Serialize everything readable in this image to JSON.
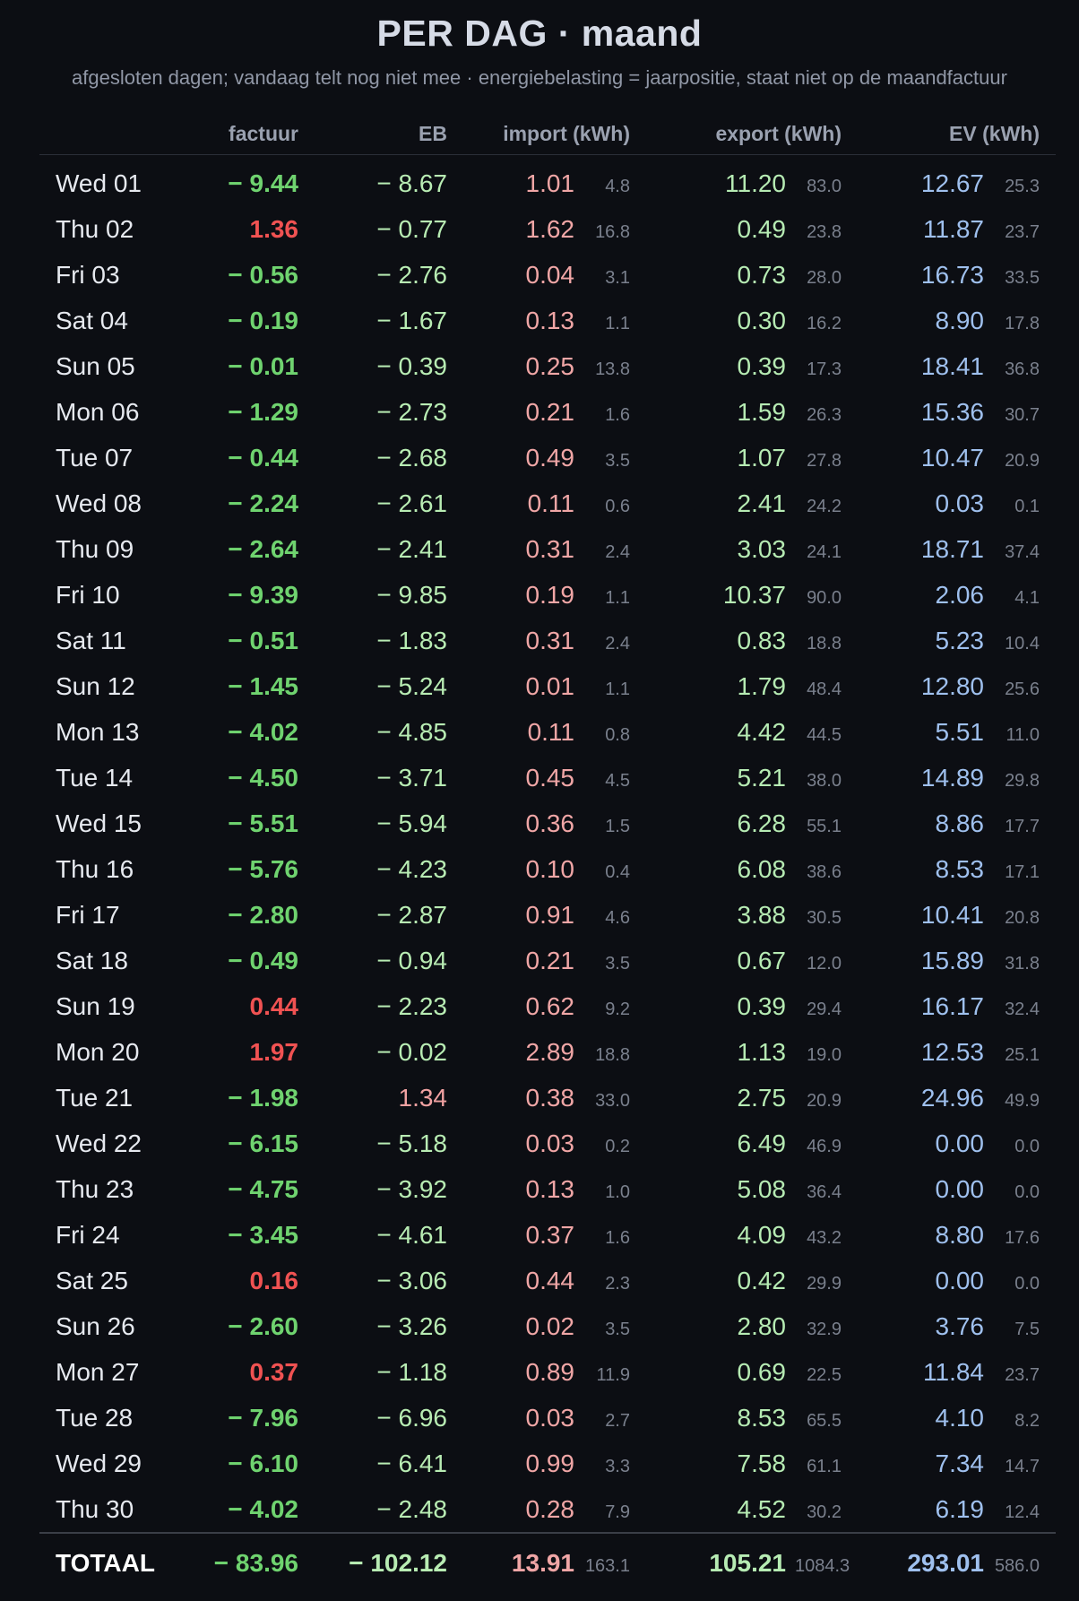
{
  "header": {
    "title": "PER DAG · maand",
    "subtitle": "afgesloten dagen; vandaag telt nog niet mee · energiebelasting = jaarpositie, staat niet op de maandfactuur"
  },
  "columns": {
    "day": "",
    "factuur": "factuur",
    "eb": "EB",
    "import": "import (kWh)",
    "export": "export (kWh)",
    "ev": "EV (kWh)"
  },
  "colors": {
    "negative_invoice": "#6fd36f",
    "positive_invoice": "#f05252",
    "import": "#f0a6a6",
    "export": "#b6ebb3",
    "ev": "#9fc0ee",
    "background": "#0c0e13"
  },
  "rows": [
    {
      "day": "Wed 01",
      "factuur": "− 9.44",
      "factuur_sign": "neg",
      "eb": "− 8.67",
      "eb_sign": "neg",
      "import": "1.01",
      "import_sub": "4.8",
      "export": "11.20",
      "export_sub": "83.0",
      "ev": "12.67",
      "ev_sub": "25.3"
    },
    {
      "day": "Thu 02",
      "factuur": "1.36",
      "factuur_sign": "pos",
      "eb": "− 0.77",
      "eb_sign": "neg",
      "import": "1.62",
      "import_sub": "16.8",
      "export": "0.49",
      "export_sub": "23.8",
      "ev": "11.87",
      "ev_sub": "23.7"
    },
    {
      "day": "Fri 03",
      "factuur": "− 0.56",
      "factuur_sign": "neg",
      "eb": "− 2.76",
      "eb_sign": "neg",
      "import": "0.04",
      "import_sub": "3.1",
      "export": "0.73",
      "export_sub": "28.0",
      "ev": "16.73",
      "ev_sub": "33.5"
    },
    {
      "day": "Sat 04",
      "factuur": "− 0.19",
      "factuur_sign": "neg",
      "eb": "− 1.67",
      "eb_sign": "neg",
      "import": "0.13",
      "import_sub": "1.1",
      "export": "0.30",
      "export_sub": "16.2",
      "ev": "8.90",
      "ev_sub": "17.8"
    },
    {
      "day": "Sun 05",
      "factuur": "− 0.01",
      "factuur_sign": "neg",
      "eb": "− 0.39",
      "eb_sign": "neg",
      "import": "0.25",
      "import_sub": "13.8",
      "export": "0.39",
      "export_sub": "17.3",
      "ev": "18.41",
      "ev_sub": "36.8"
    },
    {
      "day": "Mon 06",
      "factuur": "− 1.29",
      "factuur_sign": "neg",
      "eb": "− 2.73",
      "eb_sign": "neg",
      "import": "0.21",
      "import_sub": "1.6",
      "export": "1.59",
      "export_sub": "26.3",
      "ev": "15.36",
      "ev_sub": "30.7"
    },
    {
      "day": "Tue 07",
      "factuur": "− 0.44",
      "factuur_sign": "neg",
      "eb": "− 2.68",
      "eb_sign": "neg",
      "import": "0.49",
      "import_sub": "3.5",
      "export": "1.07",
      "export_sub": "27.8",
      "ev": "10.47",
      "ev_sub": "20.9"
    },
    {
      "day": "Wed 08",
      "factuur": "− 2.24",
      "factuur_sign": "neg",
      "eb": "− 2.61",
      "eb_sign": "neg",
      "import": "0.11",
      "import_sub": "0.6",
      "export": "2.41",
      "export_sub": "24.2",
      "ev": "0.03",
      "ev_sub": "0.1"
    },
    {
      "day": "Thu 09",
      "factuur": "− 2.64",
      "factuur_sign": "neg",
      "eb": "− 2.41",
      "eb_sign": "neg",
      "import": "0.31",
      "import_sub": "2.4",
      "export": "3.03",
      "export_sub": "24.1",
      "ev": "18.71",
      "ev_sub": "37.4"
    },
    {
      "day": "Fri 10",
      "factuur": "− 9.39",
      "factuur_sign": "neg",
      "eb": "− 9.85",
      "eb_sign": "neg",
      "import": "0.19",
      "import_sub": "1.1",
      "export": "10.37",
      "export_sub": "90.0",
      "ev": "2.06",
      "ev_sub": "4.1"
    },
    {
      "day": "Sat 11",
      "factuur": "− 0.51",
      "factuur_sign": "neg",
      "eb": "− 1.83",
      "eb_sign": "neg",
      "import": "0.31",
      "import_sub": "2.4",
      "export": "0.83",
      "export_sub": "18.8",
      "ev": "5.23",
      "ev_sub": "10.4"
    },
    {
      "day": "Sun 12",
      "factuur": "− 1.45",
      "factuur_sign": "neg",
      "eb": "− 5.24",
      "eb_sign": "neg",
      "import": "0.01",
      "import_sub": "1.1",
      "export": "1.79",
      "export_sub": "48.4",
      "ev": "12.80",
      "ev_sub": "25.6"
    },
    {
      "day": "Mon 13",
      "factuur": "− 4.02",
      "factuur_sign": "neg",
      "eb": "− 4.85",
      "eb_sign": "neg",
      "import": "0.11",
      "import_sub": "0.8",
      "export": "4.42",
      "export_sub": "44.5",
      "ev": "5.51",
      "ev_sub": "11.0"
    },
    {
      "day": "Tue 14",
      "factuur": "− 4.50",
      "factuur_sign": "neg",
      "eb": "− 3.71",
      "eb_sign": "neg",
      "import": "0.45",
      "import_sub": "4.5",
      "export": "5.21",
      "export_sub": "38.0",
      "ev": "14.89",
      "ev_sub": "29.8"
    },
    {
      "day": "Wed 15",
      "factuur": "− 5.51",
      "factuur_sign": "neg",
      "eb": "− 5.94",
      "eb_sign": "neg",
      "import": "0.36",
      "import_sub": "1.5",
      "export": "6.28",
      "export_sub": "55.1",
      "ev": "8.86",
      "ev_sub": "17.7"
    },
    {
      "day": "Thu 16",
      "factuur": "− 5.76",
      "factuur_sign": "neg",
      "eb": "− 4.23",
      "eb_sign": "neg",
      "import": "0.10",
      "import_sub": "0.4",
      "export": "6.08",
      "export_sub": "38.6",
      "ev": "8.53",
      "ev_sub": "17.1"
    },
    {
      "day": "Fri 17",
      "factuur": "− 2.80",
      "factuur_sign": "neg",
      "eb": "− 2.87",
      "eb_sign": "neg",
      "import": "0.91",
      "import_sub": "4.6",
      "export": "3.88",
      "export_sub": "30.5",
      "ev": "10.41",
      "ev_sub": "20.8"
    },
    {
      "day": "Sat 18",
      "factuur": "− 0.49",
      "factuur_sign": "neg",
      "eb": "− 0.94",
      "eb_sign": "neg",
      "import": "0.21",
      "import_sub": "3.5",
      "export": "0.67",
      "export_sub": "12.0",
      "ev": "15.89",
      "ev_sub": "31.8"
    },
    {
      "day": "Sun 19",
      "factuur": "0.44",
      "factuur_sign": "pos",
      "eb": "− 2.23",
      "eb_sign": "neg",
      "import": "0.62",
      "import_sub": "9.2",
      "export": "0.39",
      "export_sub": "29.4",
      "ev": "16.17",
      "ev_sub": "32.4"
    },
    {
      "day": "Mon 20",
      "factuur": "1.97",
      "factuur_sign": "pos",
      "eb": "− 0.02",
      "eb_sign": "neg",
      "import": "2.89",
      "import_sub": "18.8",
      "export": "1.13",
      "export_sub": "19.0",
      "ev": "12.53",
      "ev_sub": "25.1"
    },
    {
      "day": "Tue 21",
      "factuur": "− 1.98",
      "factuur_sign": "neg",
      "eb": "1.34",
      "eb_sign": "pos",
      "import": "0.38",
      "import_sub": "33.0",
      "export": "2.75",
      "export_sub": "20.9",
      "ev": "24.96",
      "ev_sub": "49.9"
    },
    {
      "day": "Wed 22",
      "factuur": "− 6.15",
      "factuur_sign": "neg",
      "eb": "− 5.18",
      "eb_sign": "neg",
      "import": "0.03",
      "import_sub": "0.2",
      "export": "6.49",
      "export_sub": "46.9",
      "ev": "0.00",
      "ev_sub": "0.0"
    },
    {
      "day": "Thu 23",
      "factuur": "− 4.75",
      "factuur_sign": "neg",
      "eb": "− 3.92",
      "eb_sign": "neg",
      "import": "0.13",
      "import_sub": "1.0",
      "export": "5.08",
      "export_sub": "36.4",
      "ev": "0.00",
      "ev_sub": "0.0"
    },
    {
      "day": "Fri 24",
      "factuur": "− 3.45",
      "factuur_sign": "neg",
      "eb": "− 4.61",
      "eb_sign": "neg",
      "import": "0.37",
      "import_sub": "1.6",
      "export": "4.09",
      "export_sub": "43.2",
      "ev": "8.80",
      "ev_sub": "17.6"
    },
    {
      "day": "Sat 25",
      "factuur": "0.16",
      "factuur_sign": "pos",
      "eb": "− 3.06",
      "eb_sign": "neg",
      "import": "0.44",
      "import_sub": "2.3",
      "export": "0.42",
      "export_sub": "29.9",
      "ev": "0.00",
      "ev_sub": "0.0"
    },
    {
      "day": "Sun 26",
      "factuur": "− 2.60",
      "factuur_sign": "neg",
      "eb": "− 3.26",
      "eb_sign": "neg",
      "import": "0.02",
      "import_sub": "3.5",
      "export": "2.80",
      "export_sub": "32.9",
      "ev": "3.76",
      "ev_sub": "7.5"
    },
    {
      "day": "Mon 27",
      "factuur": "0.37",
      "factuur_sign": "pos",
      "eb": "− 1.18",
      "eb_sign": "neg",
      "import": "0.89",
      "import_sub": "11.9",
      "export": "0.69",
      "export_sub": "22.5",
      "ev": "11.84",
      "ev_sub": "23.7"
    },
    {
      "day": "Tue 28",
      "factuur": "− 7.96",
      "factuur_sign": "neg",
      "eb": "− 6.96",
      "eb_sign": "neg",
      "import": "0.03",
      "import_sub": "2.7",
      "export": "8.53",
      "export_sub": "65.5",
      "ev": "4.10",
      "ev_sub": "8.2"
    },
    {
      "day": "Wed 29",
      "factuur": "− 6.10",
      "factuur_sign": "neg",
      "eb": "− 6.41",
      "eb_sign": "neg",
      "import": "0.99",
      "import_sub": "3.3",
      "export": "7.58",
      "export_sub": "61.1",
      "ev": "7.34",
      "ev_sub": "14.7"
    },
    {
      "day": "Thu 30",
      "factuur": "− 4.02",
      "factuur_sign": "neg",
      "eb": "− 2.48",
      "eb_sign": "neg",
      "import": "0.28",
      "import_sub": "7.9",
      "export": "4.52",
      "export_sub": "30.2",
      "ev": "6.19",
      "ev_sub": "12.4"
    }
  ],
  "totals": {
    "label": "TOTAAL",
    "factuur": "− 83.96",
    "factuur_sign": "neg",
    "eb": "− 102.12",
    "eb_sign": "neg",
    "import": "13.91",
    "import_sub": "163.1",
    "export": "105.21",
    "export_sub": "1084.3",
    "ev": "293.01",
    "ev_sub": "586.0"
  }
}
